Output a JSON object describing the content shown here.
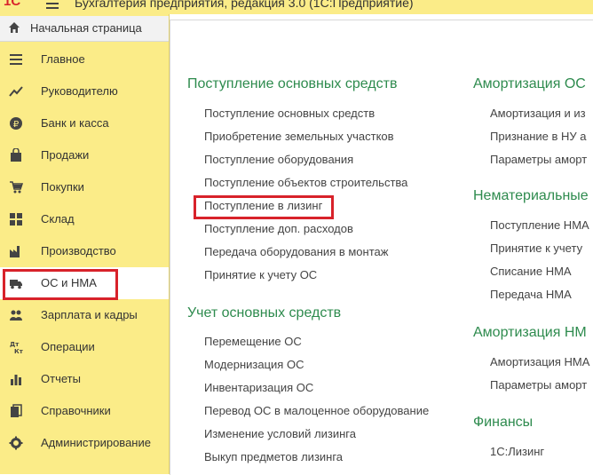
{
  "window": {
    "title": "Бухгалтерия предприятия, редакция 3.0   (1С:Предприятие)",
    "logo": "1С"
  },
  "sidebar": {
    "home_label": "Начальная страница",
    "items": [
      {
        "label": "Главное",
        "icon": "menu-lines-icon"
      },
      {
        "label": "Руководителю",
        "icon": "trend-icon"
      },
      {
        "label": "Банк и касса",
        "icon": "ruble-coin-icon"
      },
      {
        "label": "Продажи",
        "icon": "shopping-bag-icon"
      },
      {
        "label": "Покупки",
        "icon": "cart-icon"
      },
      {
        "label": "Склад",
        "icon": "grid-icon"
      },
      {
        "label": "Производство",
        "icon": "factory-icon"
      },
      {
        "label": "ОС и НМА",
        "icon": "truck-icon",
        "active": true
      },
      {
        "label": "Зарплата и кадры",
        "icon": "people-icon"
      },
      {
        "label": "Операции",
        "icon": "debit-credit-icon"
      },
      {
        "label": "Отчеты",
        "icon": "bar-chart-icon"
      },
      {
        "label": "Справочники",
        "icon": "books-icon"
      },
      {
        "label": "Администрирование",
        "icon": "gear-icon"
      }
    ]
  },
  "main": {
    "col1": {
      "sections": [
        {
          "title": "Поступление основных средств",
          "links": [
            "Поступление основных средств",
            "Приобретение земельных участков",
            "Поступление оборудования",
            "Поступление объектов строительства",
            "Поступление в лизинг",
            "Поступление доп. расходов",
            "Передача оборудования в монтаж",
            "Принятие к учету ОС"
          ]
        },
        {
          "title": "Учет основных средств",
          "links": [
            "Перемещение ОС",
            "Модернизация ОС",
            "Инвентаризация ОС",
            "Перевод ОС в малоценное оборудование",
            "Изменение условий лизинга",
            "Выкуп предметов лизинга"
          ]
        }
      ]
    },
    "col2": {
      "sections": [
        {
          "title": "Амортизация ОС",
          "links": [
            "Амортизация и из",
            "Признание в НУ а",
            "Параметры аморт"
          ]
        },
        {
          "title": "Нематериальные",
          "links": [
            "Поступление НМА",
            "Принятие к учету",
            "Списание НМА",
            "Передача НМА"
          ]
        },
        {
          "title": "Амортизация НМ",
          "links": [
            "Амортизация НМА",
            "Параметры аморт"
          ]
        },
        {
          "title": "Финансы",
          "links": [
            "1С:Лизинг"
          ]
        }
      ]
    }
  },
  "colors": {
    "sidebar_bg": "#fbec88",
    "accent_red": "#d8222a",
    "section_green": "#2e8b4e"
  }
}
